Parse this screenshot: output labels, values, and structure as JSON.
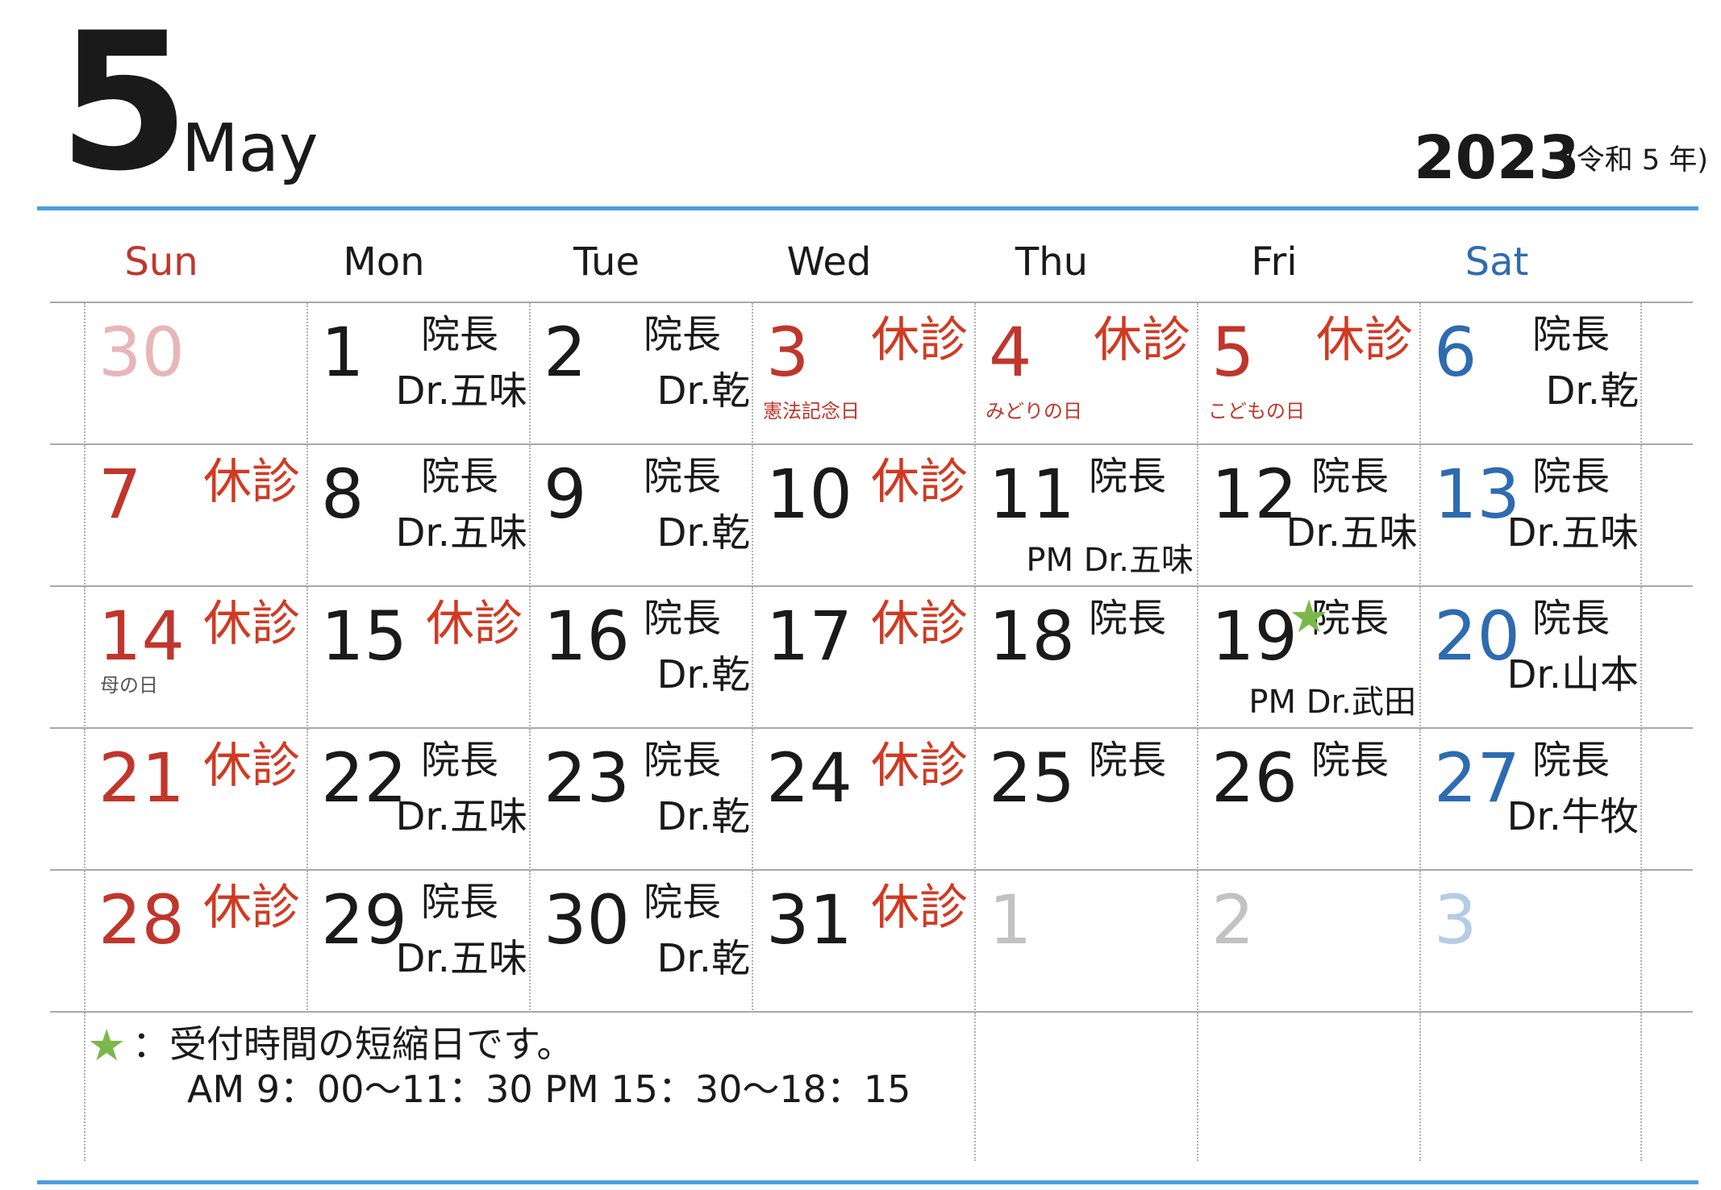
{
  "header": {
    "month_number": "5",
    "month_name": "May",
    "year": "2023",
    "era": "(令和 5 年)"
  },
  "weekdays": [
    "Sun",
    "Mon",
    "Tue",
    "Wed",
    "Thu",
    "Fri",
    "Sat"
  ],
  "colors": {
    "red": "#c0362c",
    "blue": "#2e6bb0",
    "closed": "#d13a22",
    "star": "#7bb84a",
    "rule": "#4a9fe0"
  },
  "weeks": [
    [
      {
        "day": "30",
        "tone": "fadered"
      },
      {
        "day": "1",
        "role": "院長",
        "doctor": "Dr.五味"
      },
      {
        "day": "2",
        "role": "院長",
        "doctor": "Dr.乾"
      },
      {
        "day": "3",
        "tone": "red",
        "closed": "休診",
        "holiday": "憲法記念日"
      },
      {
        "day": "4",
        "tone": "red",
        "closed": "休診",
        "holiday": "みどりの日"
      },
      {
        "day": "5",
        "tone": "red",
        "closed": "休診",
        "holiday": "こどもの日"
      },
      {
        "day": "6",
        "tone": "blue",
        "role": "院長",
        "doctor": "Dr.乾"
      }
    ],
    [
      {
        "day": "7",
        "tone": "red",
        "closed": "休診"
      },
      {
        "day": "8",
        "role": "院長",
        "doctor": "Dr.五味"
      },
      {
        "day": "9",
        "role": "院長",
        "doctor": "Dr.乾"
      },
      {
        "day": "10",
        "closed": "休診"
      },
      {
        "day": "11",
        "role": "院長",
        "pm": "PM Dr.五味"
      },
      {
        "day": "12",
        "role": "院長",
        "doctor": "Dr.五味"
      },
      {
        "day": "13",
        "tone": "blue",
        "role": "院長",
        "doctor": "Dr.五味"
      }
    ],
    [
      {
        "day": "14",
        "tone": "red",
        "closed": "休診",
        "holiday": "母の日",
        "holiday_tone": "grey"
      },
      {
        "day": "15",
        "closed": "休診"
      },
      {
        "day": "16",
        "role": "院長",
        "doctor": "Dr.乾"
      },
      {
        "day": "17",
        "closed": "休診"
      },
      {
        "day": "18",
        "role": "院長"
      },
      {
        "day": "19",
        "star": "★",
        "role": "院長",
        "pm": "PM Dr.武田"
      },
      {
        "day": "20",
        "tone": "blue",
        "role": "院長",
        "doctor": "Dr.山本"
      }
    ],
    [
      {
        "day": "21",
        "tone": "red",
        "closed": "休診"
      },
      {
        "day": "22",
        "role": "院長",
        "doctor": "Dr.五味"
      },
      {
        "day": "23",
        "role": "院長",
        "doctor": "Dr.乾"
      },
      {
        "day": "24",
        "closed": "休診"
      },
      {
        "day": "25",
        "role": "院長"
      },
      {
        "day": "26",
        "role": "院長"
      },
      {
        "day": "27",
        "tone": "blue",
        "role": "院長",
        "doctor": "Dr.牛牧"
      }
    ],
    [
      {
        "day": "28",
        "tone": "red",
        "closed": "休診"
      },
      {
        "day": "29",
        "role": "院長",
        "doctor": "Dr.五味"
      },
      {
        "day": "30",
        "role": "院長",
        "doctor": "Dr.乾"
      },
      {
        "day": "31",
        "closed": "休診"
      },
      {
        "day": "1",
        "tone": "grey"
      },
      {
        "day": "2",
        "tone": "grey"
      },
      {
        "day": "3",
        "tone": "fadeblue"
      }
    ]
  ],
  "legend": {
    "star": "★",
    "text": "：受付時間の短縮日です。",
    "hours": "AM 9：00〜11：30  PM 15：30〜18：15"
  }
}
